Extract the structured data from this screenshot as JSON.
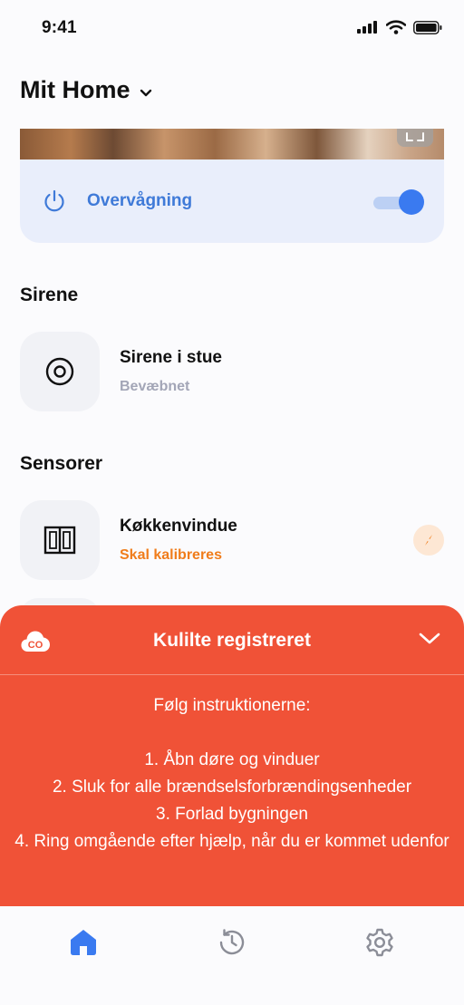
{
  "status_bar": {
    "time": "9:41"
  },
  "header": {
    "title": "Mit Home"
  },
  "monitoring": {
    "label": "Overvågning",
    "enabled": true
  },
  "siren_section": {
    "title": "Sirene",
    "device": {
      "name": "Sirene i stue",
      "status": "Bevæbnet"
    }
  },
  "sensor_section": {
    "title": "Sensorer",
    "device": {
      "name": "Køkkenvindue",
      "status": "Skal kalibreres"
    }
  },
  "alert": {
    "badge": "CO",
    "title": "Kulilte registreret",
    "intro": "Følg instruktionerne:",
    "steps": [
      "1. Åbn døre og vinduer",
      "2. Sluk for alle brændselsforbrændingsenheder",
      "3. Forlad bygningen",
      "4. Ring omgående efter hjælp, når du er kommet udenfor"
    ]
  },
  "tab_bar": {
    "items": [
      {
        "icon": "home-icon",
        "active": true
      },
      {
        "icon": "history-icon",
        "active": false
      },
      {
        "icon": "settings-icon",
        "active": false
      }
    ]
  },
  "colors": {
    "accent": "#3a7af0",
    "alert": "#f05237",
    "warning": "#f07c1a"
  }
}
